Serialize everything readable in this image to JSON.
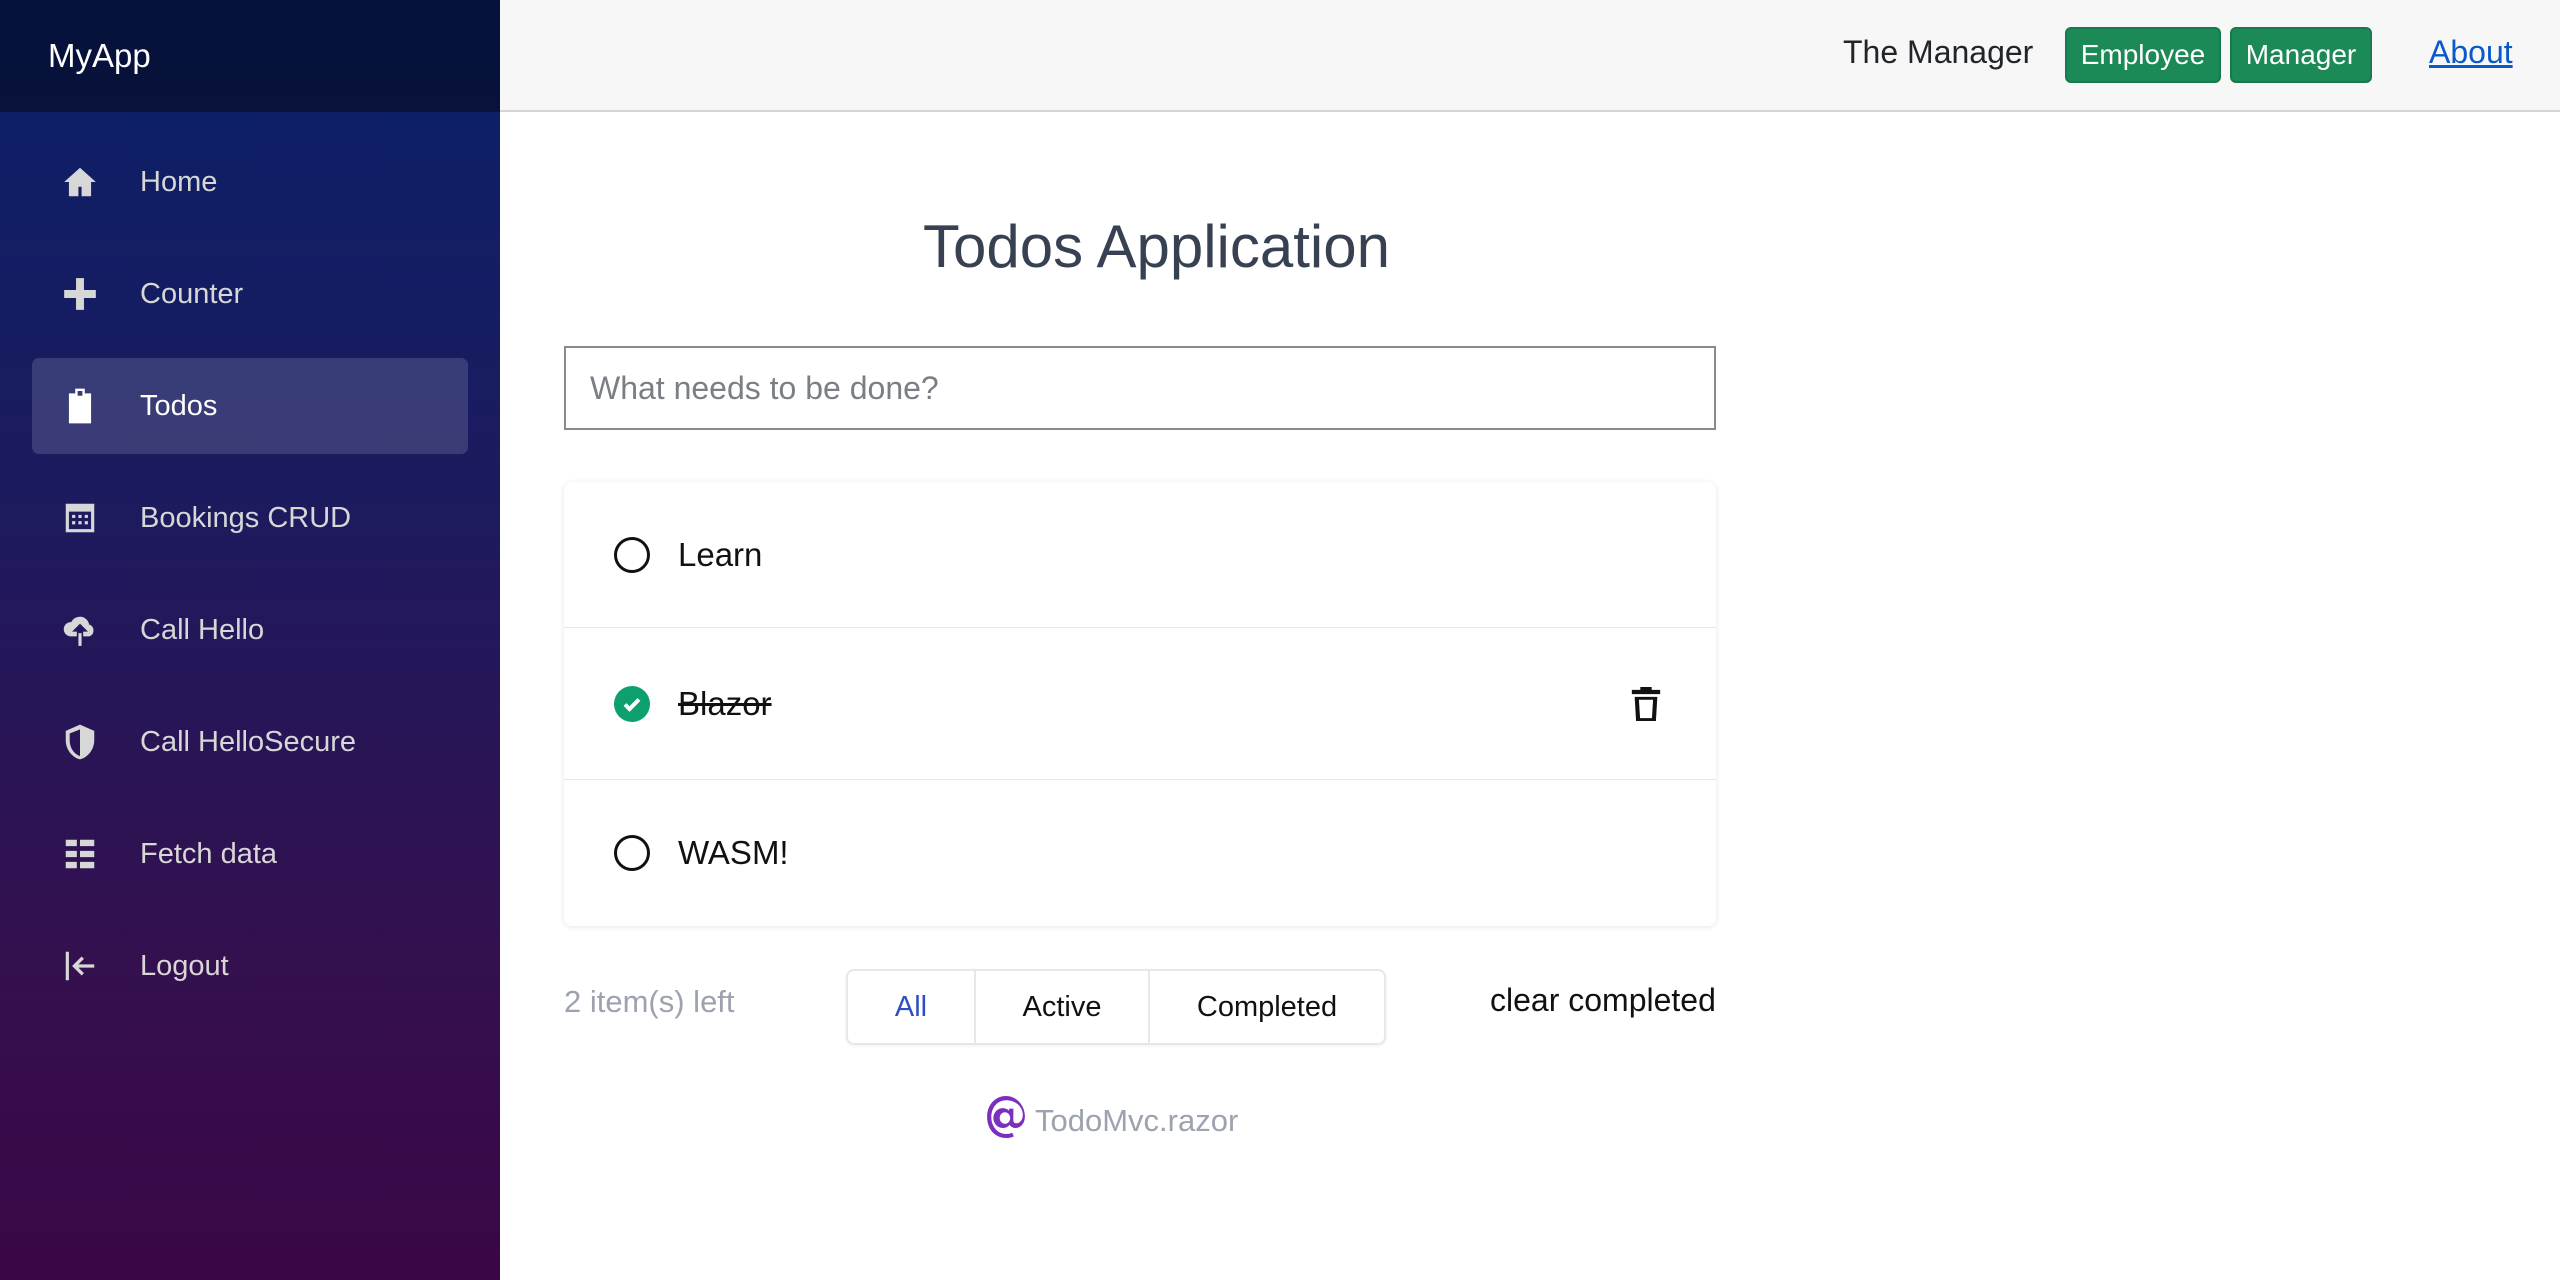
{
  "app": {
    "brand": "MyApp"
  },
  "sidebar": {
    "items": [
      {
        "label": "Home",
        "icon": "home-icon",
        "active": false
      },
      {
        "label": "Counter",
        "icon": "plus-icon",
        "active": false
      },
      {
        "label": "Todos",
        "icon": "clipboard-icon",
        "active": true
      },
      {
        "label": "Bookings CRUD",
        "icon": "calendar-icon",
        "active": false
      },
      {
        "label": "Call Hello",
        "icon": "cloud-upload-icon",
        "active": false
      },
      {
        "label": "Call HelloSecure",
        "icon": "shield-icon",
        "active": false
      },
      {
        "label": "Fetch data",
        "icon": "list-icon",
        "active": false
      },
      {
        "label": "Logout",
        "icon": "logout-icon",
        "active": false
      }
    ]
  },
  "header": {
    "user_name": "The Manager",
    "roles": [
      "Employee",
      "Manager"
    ],
    "about": "About",
    "role_color": "#1b8a57"
  },
  "main": {
    "title": "Todos Application",
    "new_todo_placeholder": "What needs to be done?",
    "todos": [
      {
        "text": "Learn",
        "completed": false
      },
      {
        "text": "Blazor",
        "completed": true
      },
      {
        "text": "WASM!",
        "completed": false
      }
    ],
    "items_left": "2 item(s) left",
    "filters": [
      {
        "label": "All",
        "active": true
      },
      {
        "label": "Active",
        "active": false
      },
      {
        "label": "Completed",
        "active": false
      }
    ],
    "clear_completed": "clear completed",
    "source_file": "TodoMvc.razor",
    "check_color": "#0e9f6e"
  }
}
